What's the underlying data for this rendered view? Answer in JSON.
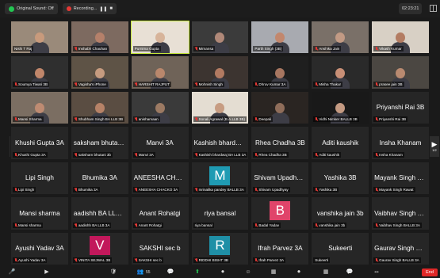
{
  "topbar": {
    "sound_label": "Original Sound: Off",
    "recording_label": "Recording...",
    "pause_glyph": "❚❚",
    "stop_glyph": "■",
    "time": "02:23:21"
  },
  "nav": {
    "left_page": "1/2",
    "right_page": "1/2"
  },
  "tiles": [
    {
      "label": "Nishi T Raj",
      "video": true,
      "skin": "#c89a7c",
      "bg": "#9a8a7a",
      "muted": false
    },
    {
      "label": "Inshabh Chauhan",
      "video": true,
      "skin": "#b5806a",
      "bg": "#7d6a60",
      "muted": true
    },
    {
      "label": "Purnima Gupta",
      "video": true,
      "skin": "#d7b49a",
      "bg": "#e8e0d5",
      "muted": false,
      "active": true
    },
    {
      "label": "Mimansa",
      "video": true,
      "skin": "#b08878",
      "bg": "#3b3b3b",
      "muted": true
    },
    {
      "label": "Parth Singh (3B)",
      "video": true,
      "skin": "#c2876d",
      "bg": "#a8aab0",
      "muted": false
    },
    {
      "label": "Anshika Jain",
      "video": true,
      "skin": "#c29a84",
      "bg": "#7a7068",
      "muted": true
    },
    {
      "label": "Vikash Kumar",
      "video": true,
      "skin": "#b37c62",
      "bg": "#d8d0c5",
      "muted": true
    },
    {
      "label": "Soumya Tiwari 3B",
      "video": true,
      "skin": "#c0866a",
      "bg": "#2f2f2f",
      "muted": true
    },
    {
      "label": "Vagisha's iPhone",
      "video": true,
      "skin": "#c69b7f",
      "bg": "#5e5346",
      "muted": true
    },
    {
      "label": "HARSHIT RAJPUT",
      "video": true,
      "skin": "#b9876c",
      "bg": "#6f6358",
      "muted": true
    },
    {
      "label": "Mohnish Singh",
      "video": true,
      "skin": "#b27a61",
      "bg": "#3c3430",
      "muted": true
    },
    {
      "label": "Dhruv Kumar 3A",
      "video": true,
      "skin": "#a77660",
      "bg": "#1f1f1f",
      "muted": true
    },
    {
      "label": "Misha Thakur",
      "video": true,
      "skin": "#c88f76",
      "bg": "#2a2a2a",
      "muted": true
    },
    {
      "label": "prasee jain 3B",
      "video": true,
      "skin": "#b98a70",
      "bg": "#4b4742",
      "muted": true
    },
    {
      "label": "Mansi Sharma",
      "video": true,
      "skin": "#be8b72",
      "bg": "#7b6e62",
      "muted": true
    },
    {
      "label": "Shubham Singh BA LLB 3B",
      "video": true,
      "skin": "#b68267",
      "bg": "#5a4d42",
      "muted": true
    },
    {
      "label": "anishamaan",
      "video": true,
      "skin": "#9c7a63",
      "bg": "#3a3a3a",
      "muted": true
    },
    {
      "label": "Sonali Agrawal (B.A.LLB 3B)",
      "video": true,
      "skin": "#c79c82",
      "bg": "#e4ddd2",
      "muted": true
    },
    {
      "label": "Deepali",
      "video": true,
      "skin": "#8f6d5a",
      "bg": "#2a2522",
      "muted": true
    },
    {
      "label": "Vidhi Nimker BALLB 3B",
      "video": true,
      "skin": "#c49a82",
      "bg": "#191919",
      "muted": true
    },
    {
      "label": "Priyanshi Rai 3B",
      "name": "Priyanshi Rai 3B",
      "video": false,
      "muted": true
    },
    {
      "label": "Khushi Gupta 3A",
      "name": "Khushi Gupta 3A",
      "video": false,
      "muted": true
    },
    {
      "label": "saksham bhutani 3b",
      "name": "saksham bhutani...",
      "video": false,
      "muted": true
    },
    {
      "label": "Manvi 3A",
      "name": "Manvi 3A",
      "video": false,
      "muted": true
    },
    {
      "label": "Kashish bhardwaj BA LLB 3A",
      "name": "Kashish bhardwaj...",
      "video": false,
      "muted": true
    },
    {
      "label": "Rhea Chadha 3B",
      "name": "Rhea Chadha 3B",
      "video": false,
      "muted": true
    },
    {
      "label": "Aditi kaushik",
      "name": "Aditi kaushik",
      "video": false,
      "muted": true
    },
    {
      "label": "Insha Khanam",
      "name": "Insha Khanam",
      "video": false,
      "muted": true
    },
    {
      "label": "Lipi Singh",
      "name": "Lipi Singh",
      "video": false,
      "muted": true
    },
    {
      "label": "Bhumika 3A",
      "name": "Bhumika 3A",
      "video": false,
      "muted": true
    },
    {
      "label": "ANEESHA CHACKO 3A",
      "name": "ANEESHA CHACK...",
      "video": false,
      "muted": true
    },
    {
      "label": "mrinalika pandey BALLB 3A",
      "avatar": "M",
      "avatar_color": "#1f9bb3",
      "video": false,
      "muted": true
    },
    {
      "label": "Shivam Upadhyay",
      "name": "Shivam Upadhyay",
      "video": false,
      "muted": true
    },
    {
      "label": "Yashika 3B",
      "name": "Yashika 3B",
      "video": false,
      "muted": true
    },
    {
      "label": "Mayank Singh Rawat",
      "name": "Mayank Singh Ra...",
      "video": false,
      "muted": true
    },
    {
      "label": "Mansi sharma",
      "name": "Mansi sharma",
      "video": false,
      "muted": true
    },
    {
      "label": "aadishh BA LLB 3A",
      "name": "aadishh BA LLB 3A",
      "video": false,
      "muted": true
    },
    {
      "label": "Anant Rohatgi",
      "name": "Anant Rohatgi",
      "video": false,
      "muted": true
    },
    {
      "label": "riya bansal",
      "name": "riya bansal",
      "video": false,
      "muted": false
    },
    {
      "label": "Badal Yadav",
      "avatar": "B",
      "avatar_color": "#e0446a",
      "video": false,
      "muted": true
    },
    {
      "label": "vanshika jain 3b",
      "name": "vanshika jain 3b",
      "video": false,
      "muted": true
    },
    {
      "label": "Vaibhav Singh BALLB 3A",
      "name": "Vaibhav Singh BAL...",
      "video": false,
      "muted": true
    },
    {
      "label": "Ayushi Yadav 3A",
      "name": "Ayushi Yadav 3A",
      "video": false,
      "muted": true
    },
    {
      "label": "VINITA SEJWAL 3B",
      "avatar": "V",
      "avatar_color": "#c2185b",
      "video": false,
      "muted": true
    },
    {
      "label": "SAKSHI sec b",
      "name": "SAKSHI sec b",
      "video": false,
      "muted": true
    },
    {
      "label": "RIDDHI BISHT 3B",
      "avatar": "R",
      "avatar_color": "#1f8fa6",
      "video": false,
      "muted": true
    },
    {
      "label": "Ifrah Parvez 3A",
      "name": "Ifrah Parvez 3A",
      "video": false,
      "muted": true
    },
    {
      "label": "Sukeerti",
      "name": "Sukeerti",
      "video": false,
      "muted": false
    },
    {
      "label": "Gaurav Singh BALLB 3A",
      "name": "Gaurav Singh BAL...",
      "video": false,
      "muted": true
    }
  ],
  "toolbar": {
    "participants_count": "55",
    "end_label": "End",
    "mic_glyph": "🎤",
    "video_glyph": "▶",
    "security_glyph": "🛡",
    "participants_glyph": "👥",
    "chat_glyph": "💬",
    "share_glyph": "⬆",
    "record_glyph": "⏺",
    "reactions_glyph": "☺",
    "apps_glyph": "▦",
    "more_glyph": "•••"
  },
  "colors": {
    "active_border": "#c7e83b",
    "muted_red": "#e53935",
    "end_red": "#e02828"
  }
}
